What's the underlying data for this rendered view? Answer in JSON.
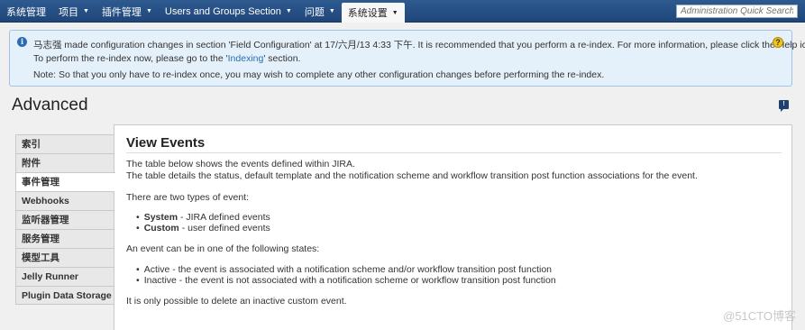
{
  "nav": {
    "items": [
      {
        "label": "系统管理",
        "caret": false
      },
      {
        "label": "项目",
        "caret": true
      },
      {
        "label": "插件管理",
        "caret": true
      },
      {
        "label": "Users and Groups Section",
        "caret": true
      },
      {
        "label": "问题",
        "caret": true
      },
      {
        "label": "系统设置",
        "caret": true
      }
    ],
    "search_placeholder": "Administration Quick Search"
  },
  "notice": {
    "line1": "马志强 made configuration changes in section 'Field Configuration' at 17/六月/13 4:33 下午. It is recommended that you perform a re-index. For more information, please click the Help icon.",
    "line2_prefix": "To perform the re-index now, please go to the '",
    "line2_link": "Indexing",
    "line2_suffix": "' section.",
    "line3": "Note: So that you only have to re-index once, you may wish to complete any other configuration changes before performing the re-index."
  },
  "page": {
    "title": "Advanced"
  },
  "sidebar": {
    "items": [
      "索引",
      "附件",
      "事件管理",
      "Webhooks",
      "监听器管理",
      "服务管理",
      "模型工具",
      "Jelly Runner",
      "Plugin Data Storage"
    ]
  },
  "content": {
    "title": "View Events",
    "intro1": "The table below shows the events defined within JIRA.",
    "intro2": "The table details the status, default template and the notification scheme and workflow transition post function associations for the event.",
    "types_intro": "There are two types of event:",
    "type1_name": "System",
    "type1_desc": " - JIRA defined events",
    "type2_name": "Custom",
    "type2_desc": " - user defined events",
    "states_intro": "An event can be in one of the following states:",
    "state1": "Active - the event is associated with a notification scheme and/or workflow transition post function",
    "state2": "Inactive - the event is not associated with a notification scheme or workflow transition post function",
    "delete_note": "It is only possible to delete an inactive custom event."
  },
  "watermark": "@51CTO博客"
}
